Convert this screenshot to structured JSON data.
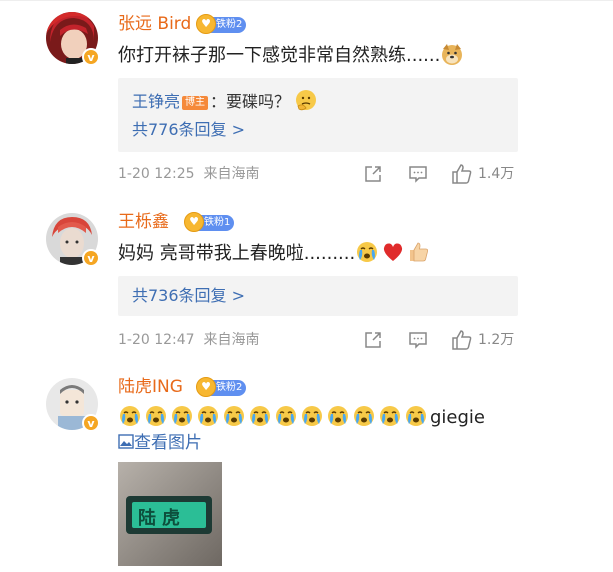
{
  "comments": [
    {
      "username": "张远 Bird",
      "fan_badge": "铁粉2",
      "text": "你打开袜子那一下感觉非常自然熟练......",
      "reply_preview": {
        "author": "王铮亮",
        "role_badge": "博主",
        "text": "：要碟吗？"
      },
      "reply_count_text": "共776条回复 >",
      "time": "1-20 12:25",
      "location": "来自海南",
      "likes": "1.4万"
    },
    {
      "username": "王栎鑫",
      "fan_badge": "铁粉1",
      "text": "妈妈 亮哥带我上春晚啦.........",
      "reply_count_text": "共736条回复 >",
      "time": "1-20 12:47",
      "location": "来自海南",
      "likes": "1.2万"
    },
    {
      "username": "陆虎ING",
      "fan_badge": "铁粉2",
      "text_suffix": "giegie",
      "emoji_count": 12,
      "view_image_label": "查看图片",
      "image_text": "陆虎"
    }
  ],
  "colors": {
    "username": "#e86a1a",
    "link_blue": "#3e6eb3",
    "meta_gray": "#999999",
    "reply_bg": "#f3f3f3",
    "badge_blue": "#5f8ff0"
  },
  "icons": [
    "share-icon",
    "comment-icon",
    "like-icon",
    "crying-emoji",
    "doge-emoji",
    "thinking-emoji",
    "red-heart-emoji",
    "thumbs-up-emoji",
    "image-icon"
  ]
}
